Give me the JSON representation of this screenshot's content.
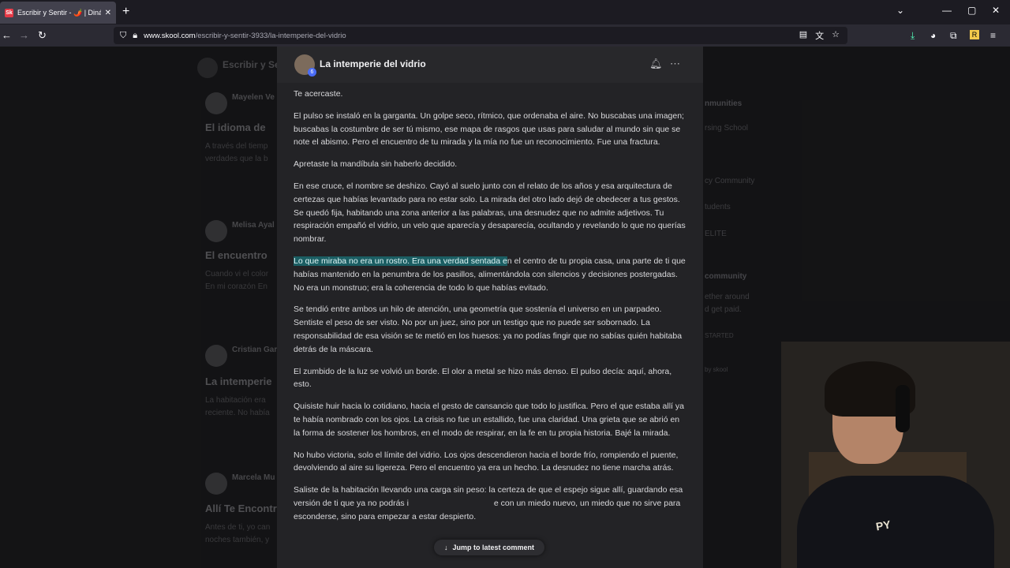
{
  "browser": {
    "tab_title": "Escribir y Sentir - 🌶️ | Dinámica",
    "favicon": "Sk",
    "url_host": "www.skool.com",
    "url_path": "/escribir-y-sentir-3933/la-intemperie-del-vidrio"
  },
  "background": {
    "brand": "Escribir y Se",
    "cards": [
      {
        "name": "Mayelen Ve",
        "title": "El idioma de",
        "lines": [
          "A través del tiemp",
          "verdades que la b"
        ]
      },
      {
        "name": "Melisa Ayal",
        "title": "El encuentro",
        "lines": [
          "Cuando vi el color",
          "En mi corazón En"
        ]
      },
      {
        "name": "Cristian Gar",
        "title": "La intemperie",
        "lines": [
          "La habitación era",
          "reciente. No había"
        ]
      },
      {
        "name": "Marcela Mu",
        "title": "Allí Te Encontr",
        "lines": [
          "Antes de ti, yo can",
          "noches también, y"
        ]
      }
    ],
    "side": [
      "nmunities",
      "rsing School",
      "cy Community",
      "tudents",
      "ELITE",
      "community",
      "ether around",
      "d get paid.",
      "STARTED",
      "by skool"
    ]
  },
  "modal": {
    "title": "La intemperie del vidrio",
    "level": "6",
    "paragraphs": [
      "Te acercaste.",
      "El pulso se instaló en la garganta. Un golpe seco, rítmico, que ordenaba el aire. No buscabas una imagen; buscabas la costumbre de ser tú mismo, ese mapa de rasgos que usas para saludar al mundo sin que se note el abismo. Pero el encuentro de tu mirada y la mía no fue un reconocimiento. Fue una fractura.",
      "Apretaste la mandíbula sin haberlo decidido.",
      "En ese cruce, el nombre se deshizo. Cayó al suelo junto con el relato de los años y esa arquitectura de certezas que habías levantado para no estar solo. La mirada del otro lado dejó de obedecer a tus gestos. Se quedó fija, habitando una zona anterior a las palabras, una desnudez que no admite adjetivos. Tu respiración empañó el vidrio, un velo que aparecía y desaparecía, ocultando y revelando lo que no querías nombrar."
    ],
    "highlight_text": "Lo que miraba no era un rostro. Era una verdad sentada e",
    "highlight_rest": "n el centro de tu propia casa, una parte de ti que habías mantenido en la penumbra de los pasillos, alimentándola con silencios y decisiones postergadas. No era un monstruo; era la coherencia de todo lo que habías evitado.",
    "paragraphs2": [
      "Se tendió entre ambos un hilo de atención, una geometría que sostenía el universo en un parpadeo. Sentiste el peso de ser visto. No por un juez, sino por un testigo que no puede ser sobornado. La responsabilidad de esa visión se te metió en los huesos: ya no podías fingir que no sabías quién habitaba detrás de la máscara.",
      "El zumbido de la luz se volvió un borde. El olor a metal se hizo más denso. El pulso decía: aquí, ahora, esto.",
      "Quisiste huir hacia lo cotidiano, hacia el gesto de cansancio que todo lo justifica. Pero el que estaba allí ya te había nombrado con los ojos. La crisis no fue un estallido, fue una claridad. Una grieta que se abrió en la forma de sostener los hombros, en el modo de respirar, en la fe en tu propia historia. Bajé la mirada.",
      "No hubo victoria, solo el límite del vidrio. Los ojos descendieron hacia el borde frío, rompiendo el puente, devolviendo al aire su ligereza. Pero el encuentro ya era un hecho. La desnudez no tiene marcha atrás.",
      "Saliste de la habitación llevando una carga sin peso: la certeza de que el espejo sigue allí, guardando esa versión de ti que ya no podrás i                                     e con un miedo nuevo, un miedo que no sirve para esconderse, sino para empezar a estar despierto."
    ],
    "jump_label": "Jump to latest comment"
  },
  "webcam": {
    "shirt_print": "PY"
  }
}
